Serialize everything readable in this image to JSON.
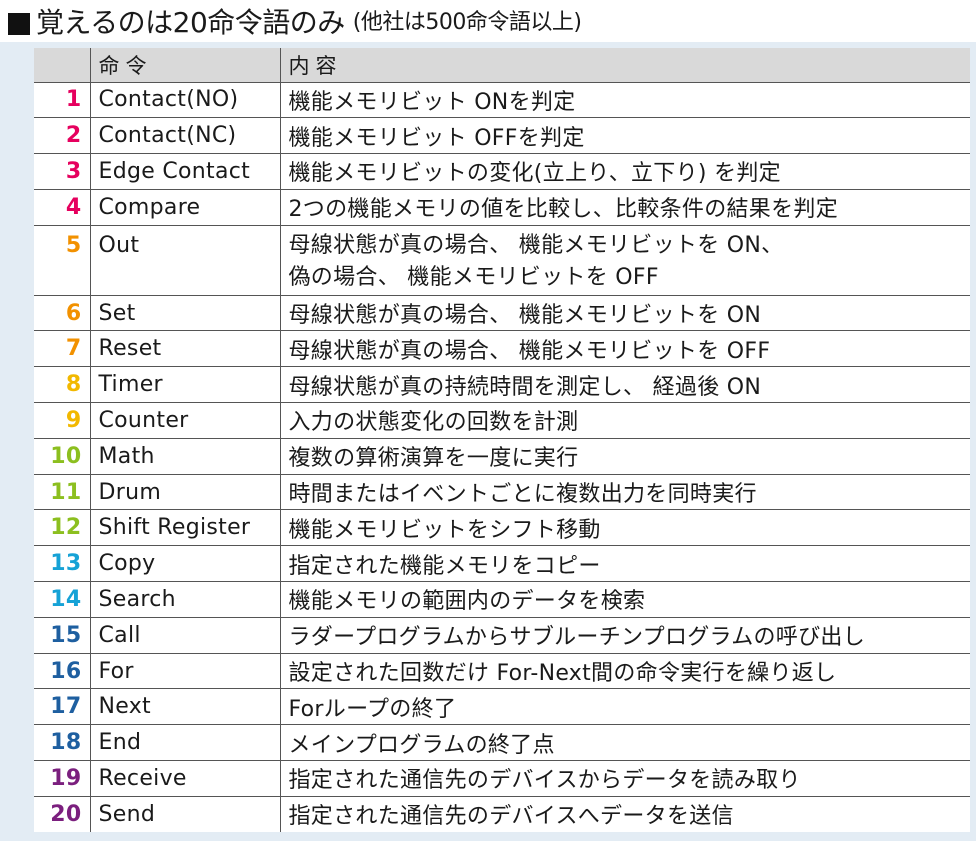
{
  "title": "覚えるのは20命令語のみ",
  "subtitle": "(他社は500命令語以上)",
  "headers": {
    "command": "命令",
    "description": "内容"
  },
  "rows": [
    {
      "num": "1",
      "cmd": "Contact(NO)",
      "desc": [
        "機能メモリビット ONを判定"
      ],
      "color": "#e6005e"
    },
    {
      "num": "2",
      "cmd": "Contact(NC)",
      "desc": [
        "機能メモリビット OFFを判定"
      ],
      "color": "#e6005e"
    },
    {
      "num": "3",
      "cmd": "Edge Contact",
      "desc": [
        "機能メモリビットの変化(立上り、立下り) を判定"
      ],
      "color": "#e6005e"
    },
    {
      "num": "4",
      "cmd": "Compare",
      "desc": [
        "2つの機能メモリの値を比較し、比較条件の結果を判定"
      ],
      "color": "#e6005e"
    },
    {
      "num": "5",
      "cmd": "Out",
      "desc": [
        "母線状態が真の場合、 機能メモリビットを ON、",
        "偽の場合、 機能メモリビットを OFF"
      ],
      "color": "#f29100"
    },
    {
      "num": "6",
      "cmd": "Set",
      "desc": [
        "母線状態が真の場合、 機能メモリビットを ON"
      ],
      "color": "#f29100"
    },
    {
      "num": "7",
      "cmd": "Reset",
      "desc": [
        "母線状態が真の場合、 機能メモリビットを OFF"
      ],
      "color": "#f29100"
    },
    {
      "num": "8",
      "cmd": "Timer",
      "desc": [
        "母線状態が真の持続時間を測定し、 経過後 ON"
      ],
      "color": "#f2b800"
    },
    {
      "num": "9",
      "cmd": "Counter",
      "desc": [
        "入力の状態変化の回数を計測"
      ],
      "color": "#f2b800"
    },
    {
      "num": "10",
      "cmd": "Math",
      "desc": [
        "複数の算術演算を一度に実行"
      ],
      "color": "#8cbf1f"
    },
    {
      "num": "11",
      "cmd": "Drum",
      "desc": [
        "時間またはイベントごとに複数出力を同時実行"
      ],
      "color": "#8cbf1f"
    },
    {
      "num": "12",
      "cmd": "Shift Register",
      "desc": [
        "機能メモリビットをシフト移動"
      ],
      "color": "#8cbf1f"
    },
    {
      "num": "13",
      "cmd": "Copy",
      "desc": [
        "指定された機能メモリをコピー"
      ],
      "color": "#16a2d6"
    },
    {
      "num": "14",
      "cmd": "Search",
      "desc": [
        "機能メモリの範囲内のデータを検索"
      ],
      "color": "#16a2d6"
    },
    {
      "num": "15",
      "cmd": "Call",
      "desc": [
        "ラダープログラムからサブルーチンプログラムの呼び出し"
      ],
      "color": "#1e5fa0"
    },
    {
      "num": "16",
      "cmd": "For",
      "desc": [
        "設定された回数だけ For-Next間の命令実行を繰り返し"
      ],
      "color": "#1e5fa0"
    },
    {
      "num": "17",
      "cmd": "Next",
      "desc": [
        "Forループの終了"
      ],
      "color": "#1e5fa0"
    },
    {
      "num": "18",
      "cmd": "End",
      "desc": [
        "メインプログラムの終了点"
      ],
      "color": "#1e5fa0"
    },
    {
      "num": "19",
      "cmd": "Receive",
      "desc": [
        "指定された通信先のデバイスからデータを読み取り"
      ],
      "color": "#7b1f7e"
    },
    {
      "num": "20",
      "cmd": "Send",
      "desc": [
        "指定された通信先のデバイスへデータを送信"
      ],
      "color": "#7b1f7e"
    }
  ]
}
